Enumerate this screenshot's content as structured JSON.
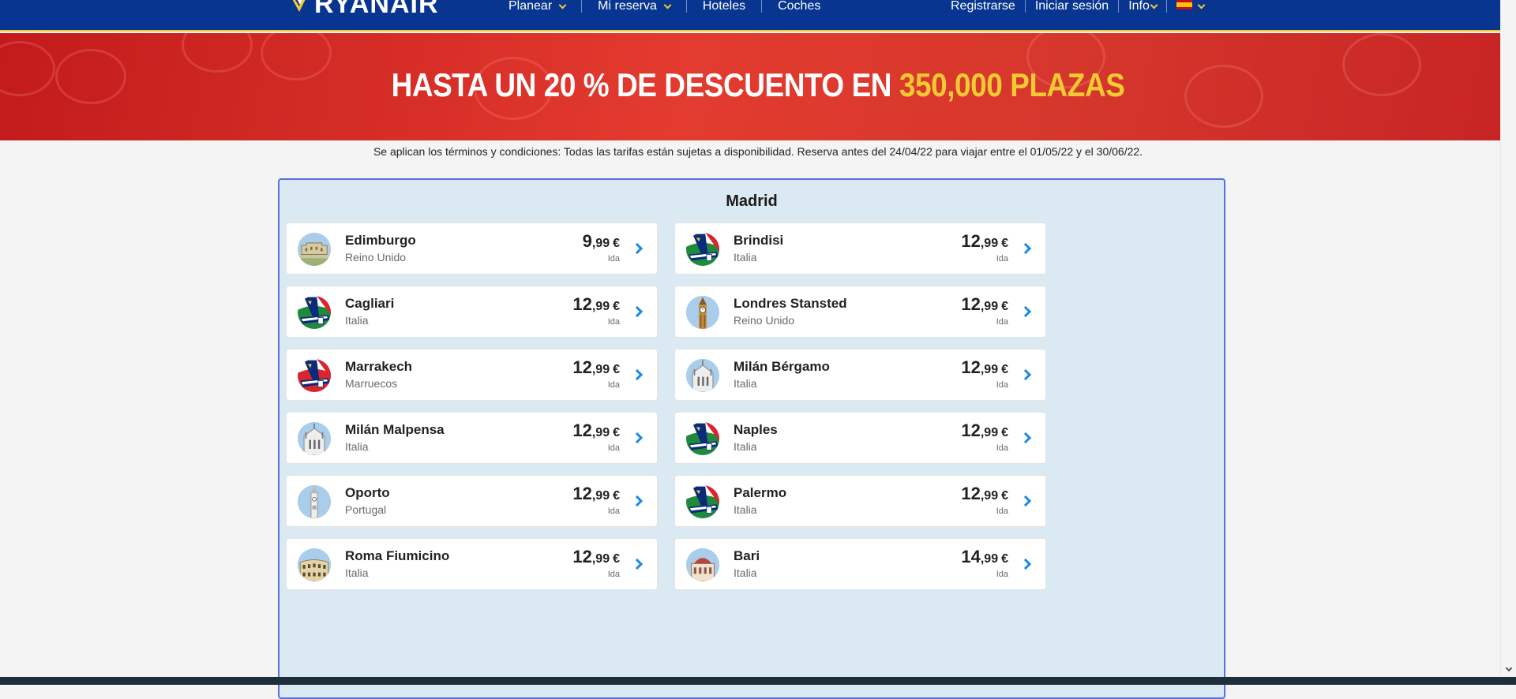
{
  "header": {
    "logo_text": "RYANAIR",
    "nav": [
      {
        "label": "Planear",
        "has_dropdown": true
      },
      {
        "label": "Mi reserva",
        "has_dropdown": true
      },
      {
        "label": "Hoteles",
        "has_dropdown": false
      },
      {
        "label": "Coches",
        "has_dropdown": false
      }
    ],
    "right": {
      "register": "Registrarse",
      "login": "Iniciar sesión",
      "info": "Info",
      "language_flag": "spain-flag-icon"
    }
  },
  "banner": {
    "title_white": "HASTA UN 20 % DE DESCUENTO EN",
    "title_highlight": "350,000 PLAZAS"
  },
  "terms": "Se aplican los términos y condiciones: Todas las tarifas están sujetas a disponibilidad. Reserva antes del 24/04/22 para viajar entre el 01/05/22 y el 30/06/22.",
  "panel": {
    "title": "Madrid",
    "fare_label": "Ida",
    "currency": "€",
    "destinations": [
      {
        "city": "Edimburgo",
        "country": "Reino Unido",
        "price_int": "9",
        "price_dec": ",99",
        "icon": "castle-icon"
      },
      {
        "city": "Brindisi",
        "country": "Italia",
        "price_int": "12",
        "price_dec": ",99",
        "icon": "plane-tail-italy-icon"
      },
      {
        "city": "Cagliari",
        "country": "Italia",
        "price_int": "12",
        "price_dec": ",99",
        "icon": "plane-tail-italy-icon"
      },
      {
        "city": "Londres Stansted",
        "country": "Reino Unido",
        "price_int": "12",
        "price_dec": ",99",
        "icon": "big-ben-icon"
      },
      {
        "city": "Marrakech",
        "country": "Marruecos",
        "price_int": "12",
        "price_dec": ",99",
        "icon": "plane-tail-morocco-icon"
      },
      {
        "city": "Milán Bérgamo",
        "country": "Italia",
        "price_int": "12",
        "price_dec": ",99",
        "icon": "cathedral-icon"
      },
      {
        "city": "Milán Malpensa",
        "country": "Italia",
        "price_int": "12",
        "price_dec": ",99",
        "icon": "cathedral-icon"
      },
      {
        "city": "Naples",
        "country": "Italia",
        "price_int": "12",
        "price_dec": ",99",
        "icon": "plane-tail-italy-icon"
      },
      {
        "city": "Oporto",
        "country": "Portugal",
        "price_int": "12",
        "price_dec": ",99",
        "icon": "clock-tower-icon"
      },
      {
        "city": "Palermo",
        "country": "Italia",
        "price_int": "12",
        "price_dec": ",99",
        "icon": "plane-tail-italy-icon"
      },
      {
        "city": "Roma Fiumicino",
        "country": "Italia",
        "price_int": "12",
        "price_dec": ",99",
        "icon": "colosseum-icon"
      },
      {
        "city": "Bari",
        "country": "Italia",
        "price_int": "14",
        "price_dec": ",99",
        "icon": "basilica-icon"
      }
    ]
  },
  "colors": {
    "header_bg": "#073590",
    "accent_yellow": "#f1c933",
    "banner_red": "#e33b2f",
    "panel_bg": "#dbeaf2",
    "arrow_blue": "#1a8ae6"
  }
}
